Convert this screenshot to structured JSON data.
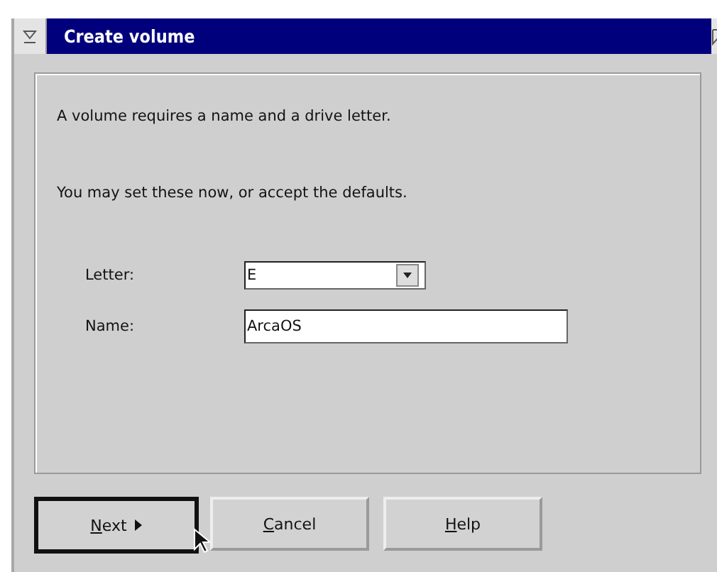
{
  "window": {
    "title": "Create volume"
  },
  "intro": [
    "A volume requires a name and a drive letter.",
    "You may set these now, or accept the defaults."
  ],
  "fields": [
    {
      "label": "Letter:",
      "kind": "combo",
      "value": "E"
    },
    {
      "label": "Name:",
      "kind": "text",
      "value": "ArcaOS"
    }
  ],
  "buttons": [
    {
      "label": "Next",
      "default": true,
      "arrow": true
    },
    {
      "label": "Cancel",
      "default": false,
      "arrow": false
    },
    {
      "label": "Help",
      "default": false,
      "arrow": false
    }
  ]
}
